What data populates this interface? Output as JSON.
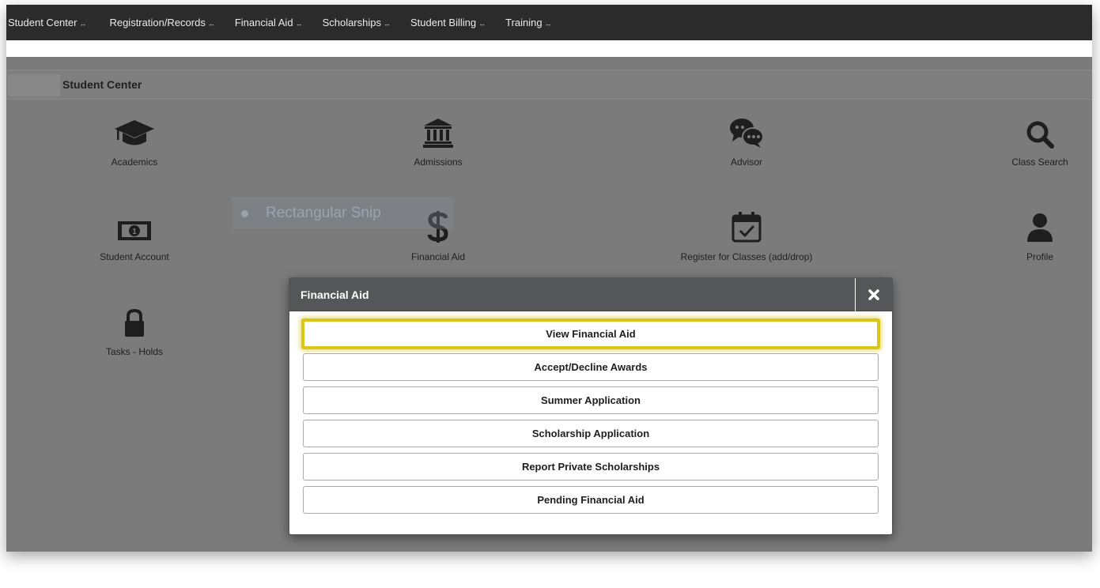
{
  "nav": {
    "items": [
      {
        "label": "Student Center"
      },
      {
        "label": "Registration/Records"
      },
      {
        "label": "Financial Aid"
      },
      {
        "label": "Scholarships"
      },
      {
        "label": "Student Billing"
      },
      {
        "label": "Training"
      }
    ],
    "caret": "↔"
  },
  "page": {
    "title": "Student Center"
  },
  "tiles": [
    {
      "label": "Academics",
      "icon": "graduation-cap-icon"
    },
    {
      "label": "Admissions",
      "icon": "institution-icon"
    },
    {
      "label": "Advisor",
      "icon": "chat-bubbles-icon"
    },
    {
      "label": "Class Search",
      "icon": "search-icon"
    },
    {
      "label": "Student Account",
      "icon": "money-icon"
    },
    {
      "label": "Financial Aid",
      "icon": "dollar-icon"
    },
    {
      "label": "Register for Classes (add/drop)",
      "icon": "calendar-check-icon"
    },
    {
      "label": "Profile",
      "icon": "user-icon"
    },
    {
      "label": "Tasks - Holds",
      "icon": "lock-icon"
    }
  ],
  "snip": {
    "label": "Rectangular Snip"
  },
  "modal": {
    "title": "Financial Aid",
    "buttons": [
      {
        "label": "View Financial Aid"
      },
      {
        "label": "Accept/Decline Awards"
      },
      {
        "label": "Summer Application"
      },
      {
        "label": "Scholarship Application"
      },
      {
        "label": "Report Private Scholarships"
      },
      {
        "label": "Pending Financial Aid"
      }
    ]
  },
  "colors": {
    "highlight": "#d8c61a",
    "nav_bg": "#2b2b2b",
    "overlay": "#7b7b7b"
  }
}
